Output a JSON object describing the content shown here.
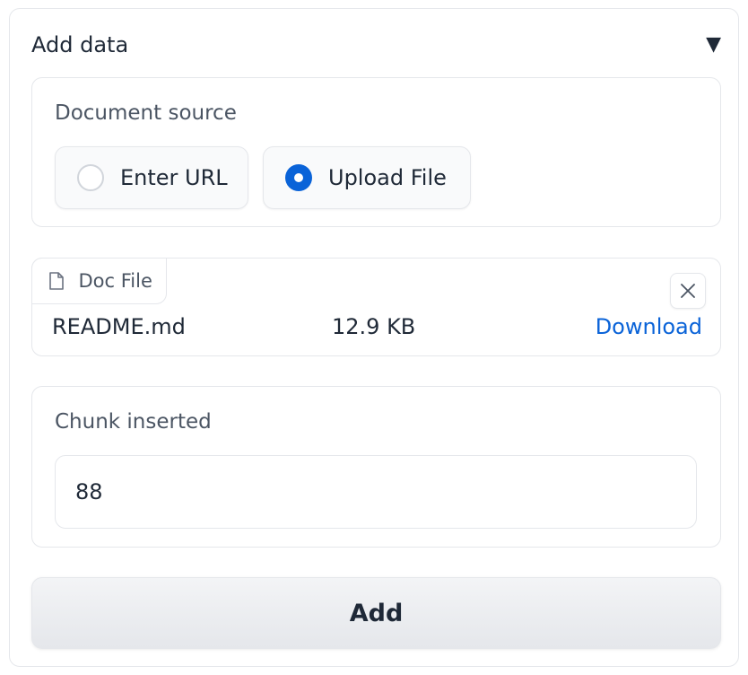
{
  "panel": {
    "title": "Add data",
    "toggle_icon": "▼"
  },
  "source": {
    "label": "Document source",
    "options": [
      {
        "label": "Enter URL",
        "checked": false
      },
      {
        "label": "Upload File",
        "checked": true
      }
    ]
  },
  "file": {
    "tab_label": "Doc File",
    "tab_icon": "document-icon",
    "close_icon": "close-icon",
    "name": "README.md",
    "size": "12.9 KB",
    "download_label": "Download"
  },
  "chunks": {
    "label": "Chunk inserted",
    "value": "88"
  },
  "actions": {
    "add_label": "Add"
  },
  "colors": {
    "accent": "#0a63d8",
    "border": "#e5e7eb"
  }
}
